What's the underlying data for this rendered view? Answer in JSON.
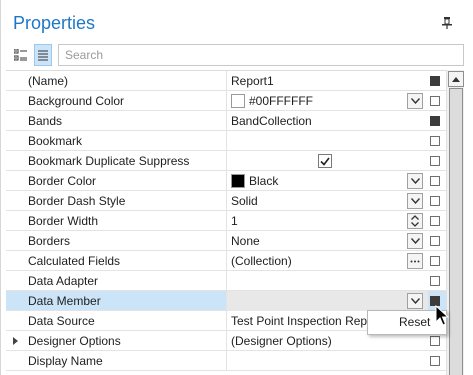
{
  "panel": {
    "title": "Properties",
    "pin_icon": "pin-icon"
  },
  "toolbar": {
    "categorized_icon": "categorized-view-icon",
    "alphabetical_icon": "alphabetical-view-icon",
    "search_placeholder": "Search",
    "search_value": ""
  },
  "properties": [
    {
      "name": "(Name)",
      "value": "Report1",
      "marker": "set"
    },
    {
      "name": "Background Color",
      "value": "#00FFFFFF",
      "swatch": "#ffffff",
      "editor": "dropdown",
      "marker": "default"
    },
    {
      "name": "Bands",
      "value": "BandCollection",
      "marker": "set"
    },
    {
      "name": "Bookmark",
      "value": "",
      "marker": "default"
    },
    {
      "name": "Bookmark Duplicate Suppress",
      "value": "",
      "checkbox": true,
      "checked": true,
      "marker": "default"
    },
    {
      "name": "Border Color",
      "value": "Black",
      "swatch": "#000000",
      "editor": "dropdown",
      "marker": "default"
    },
    {
      "name": "Border Dash Style",
      "value": "Solid",
      "editor": "dropdown",
      "marker": "default"
    },
    {
      "name": "Border Width",
      "value": "1",
      "editor": "spin",
      "marker": "default"
    },
    {
      "name": "Borders",
      "value": "None",
      "editor": "dropdown",
      "marker": "default"
    },
    {
      "name": "Calculated Fields",
      "value": "(Collection)",
      "editor": "ellipsis",
      "marker": "default"
    },
    {
      "name": "Data Adapter",
      "value": "",
      "marker": "default"
    },
    {
      "name": "Data Member",
      "value": "",
      "editor": "dropdown",
      "marker": "set",
      "selected": true
    },
    {
      "name": "Data Source",
      "value": "Test Point Inspection Repo",
      "marker": "set"
    },
    {
      "name": "Designer Options",
      "value": "(Designer Options)",
      "expandable": true,
      "marker": "default"
    },
    {
      "name": "Display Name",
      "value": "",
      "marker": "default"
    }
  ],
  "context_menu": {
    "items": [
      {
        "label": "Reset"
      }
    ]
  },
  "colors": {
    "accent": "#1e78c8",
    "selection": "#cce4f7"
  }
}
